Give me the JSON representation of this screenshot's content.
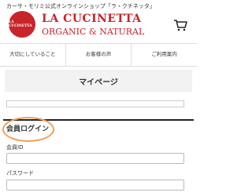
{
  "header": {
    "tagline": "カーサ・モリミ公式オンラインショップ「ラ・クチネッタ」",
    "logo_text": "LA CUCINETTA",
    "brand_line1": "LA CUCINETTA",
    "brand_line2": "ORGANIC & NATURAL",
    "brand_color": "#c8242b",
    "cart_icon": "cart-icon"
  },
  "nav": {
    "items": [
      {
        "label": "大切にしていること"
      },
      {
        "label": "お客様の声"
      },
      {
        "label": "ご利用案内"
      }
    ]
  },
  "page": {
    "title": "マイページ"
  },
  "login": {
    "heading": "会員ログイン",
    "id_label": "会員ID",
    "id_value": "",
    "password_label": "パスワード",
    "password_value": "",
    "highlight_color": "#f0a05a"
  }
}
